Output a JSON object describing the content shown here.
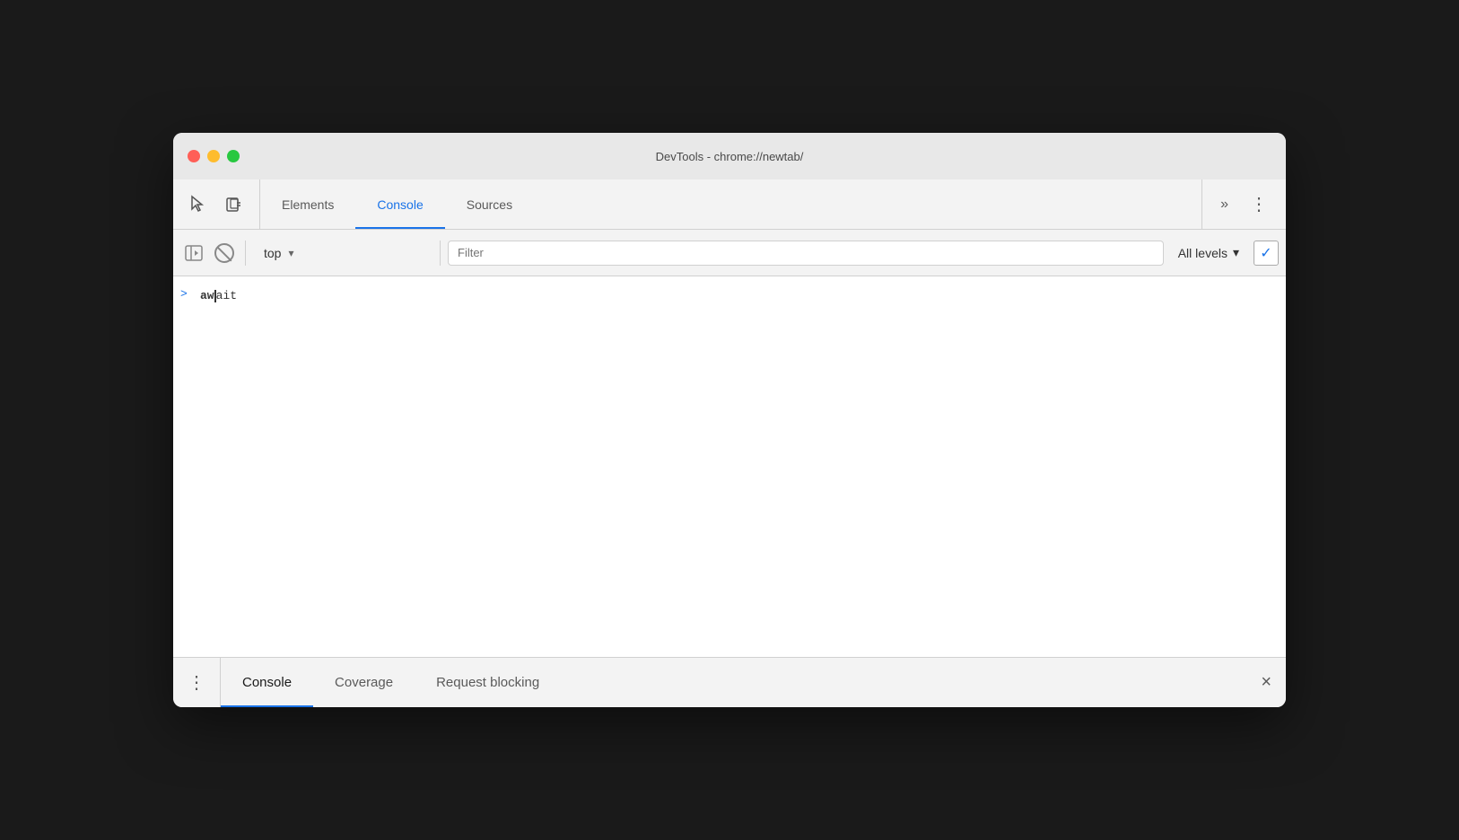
{
  "window": {
    "title": "DevTools - chrome://newtab/"
  },
  "toolbar": {
    "tabs": [
      {
        "id": "elements",
        "label": "Elements",
        "active": false
      },
      {
        "id": "console",
        "label": "Console",
        "active": true
      },
      {
        "id": "sources",
        "label": "Sources",
        "active": false
      }
    ],
    "more_tabs_label": "»",
    "more_options_label": "⋮"
  },
  "console_toolbar": {
    "context_label": "top",
    "filter_placeholder": "Filter",
    "level_label": "All levels"
  },
  "console_entries": [
    {
      "id": "entry-1",
      "arrow": ">",
      "text_bold": "aw",
      "text_normal": "ait"
    }
  ],
  "bottom_panel": {
    "tabs": [
      {
        "id": "console",
        "label": "Console",
        "active": true
      },
      {
        "id": "coverage",
        "label": "Coverage",
        "active": false
      },
      {
        "id": "request-blocking",
        "label": "Request blocking",
        "active": false
      }
    ],
    "close_label": "×"
  },
  "icons": {
    "inspect": "↖",
    "device": "▭",
    "no_entry": "⊘",
    "play_pause": "▷|",
    "sidebar": "▣",
    "chevron_down": "▾",
    "more_vert": "⋮",
    "close": "×",
    "check": "✓"
  }
}
